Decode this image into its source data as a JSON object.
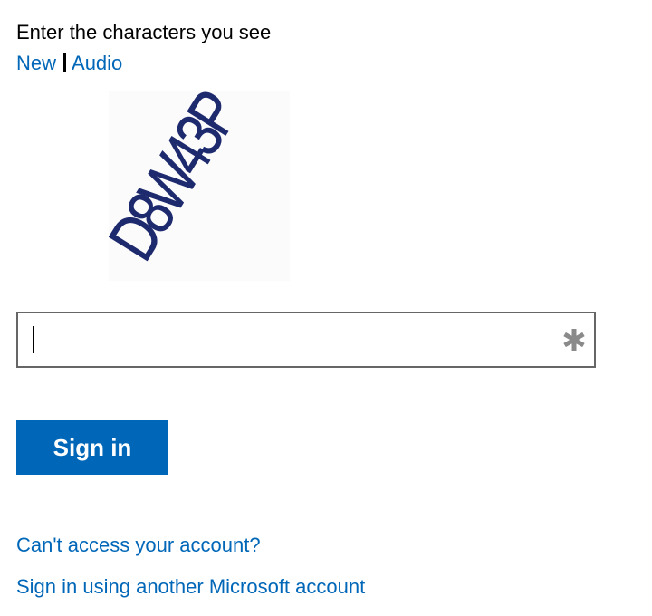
{
  "captcha": {
    "instruction": "Enter the characters you see",
    "new_link": "New",
    "separator": "|",
    "audio_link": "Audio",
    "image_text": "D8W43P",
    "input_value": ""
  },
  "form": {
    "signin_label": "Sign in"
  },
  "links": {
    "cant_access": "Can't access your account?",
    "other_account": "Sign in using another Microsoft account"
  },
  "colors": {
    "link": "#0067b8",
    "button_bg": "#0067b8",
    "button_text": "#ffffff",
    "captcha_text": "#1e2a6e",
    "input_border": "#666666",
    "required_icon": "#8a8a8a"
  },
  "icons": {
    "required": "asterisk-icon"
  }
}
